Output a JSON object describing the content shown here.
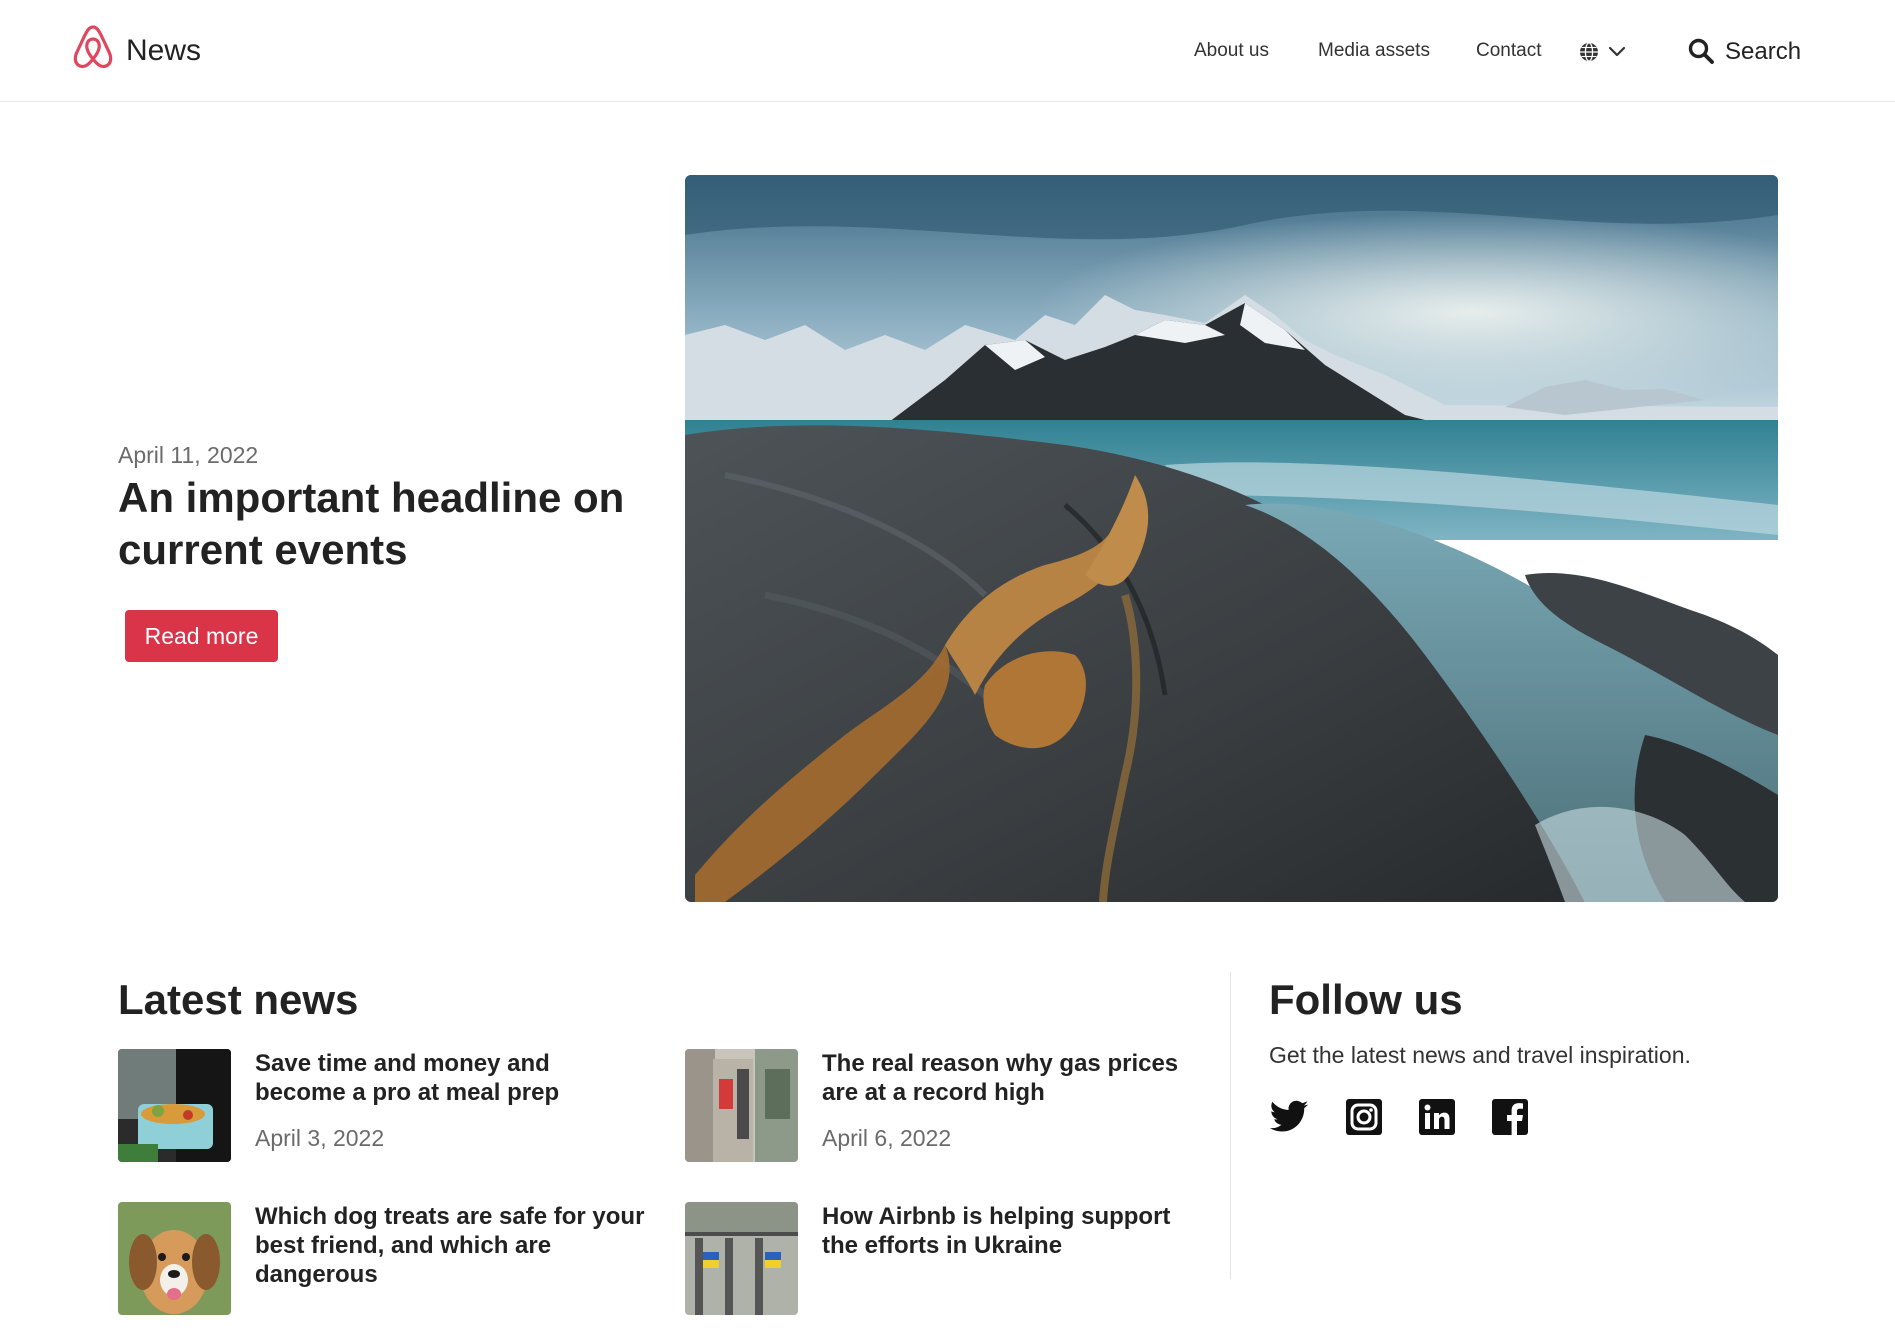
{
  "header": {
    "brand": "News",
    "nav": {
      "about": "About us",
      "media": "Media assets",
      "contact": "Contact"
    },
    "search_label": "Search",
    "brand_color": "#e0465e"
  },
  "hero": {
    "date": "April 11, 2022",
    "title": "An important headline on current events",
    "cta": "Read more",
    "cta_color": "#d93448"
  },
  "latest": {
    "title": "Latest news",
    "items": [
      {
        "title": "Save time and money and become a pro at meal prep",
        "date": "April 3, 2022"
      },
      {
        "title": "The real reason why gas prices are at a record high",
        "date": "April 6, 2022"
      },
      {
        "title": "Which dog treats are safe for your best friend, and which are dangerous",
        "date": ""
      },
      {
        "title": "How Airbnb is helping support the efforts in Ukraine",
        "date": ""
      }
    ]
  },
  "follow": {
    "title": "Follow us",
    "subtitle": "Get the latest news and travel inspiration.",
    "icons": [
      "twitter-icon",
      "instagram-icon",
      "linkedin-icon",
      "facebook-icon"
    ]
  }
}
